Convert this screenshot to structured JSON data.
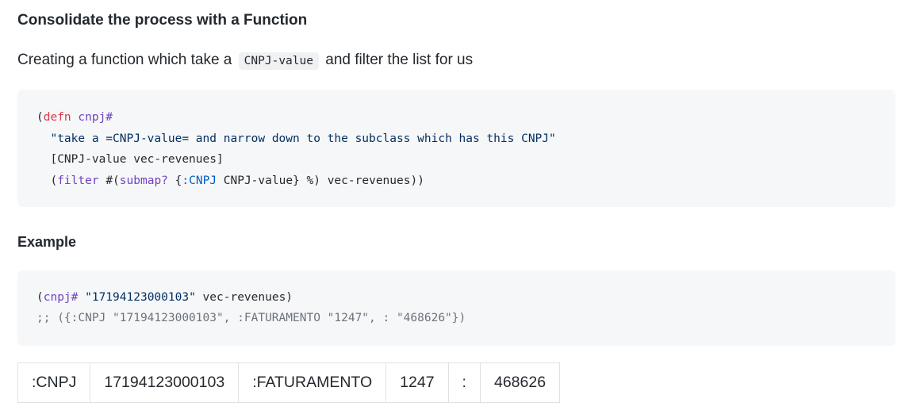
{
  "section": {
    "title": "Consolidate the process with a Function"
  },
  "intro": {
    "before": "Creating a function which take a",
    "code": "CNPJ-value",
    "after": "and filter the list for us"
  },
  "code_block_1": {
    "lines": [
      [
        {
          "t": "(",
          "c": "punc"
        },
        {
          "t": "defn",
          "c": "kw"
        },
        {
          "t": " ",
          "c": "punc"
        },
        {
          "t": "cnpj#",
          "c": "fn"
        }
      ],
      [
        {
          "t": "  ",
          "c": "punc"
        },
        {
          "t": "\"take a =CNPJ-value= and narrow down to the subclass which has this CNPJ\"",
          "c": "str"
        }
      ],
      [
        {
          "t": "  [CNPJ-value vec-revenues]",
          "c": "punc"
        }
      ],
      [
        {
          "t": "  (",
          "c": "punc"
        },
        {
          "t": "filter",
          "c": "fn"
        },
        {
          "t": " #(",
          "c": "punc"
        },
        {
          "t": "submap?",
          "c": "fn"
        },
        {
          "t": " {",
          "c": "punc"
        },
        {
          "t": ":CNPJ",
          "c": "kwd"
        },
        {
          "t": " CNPJ-value} %) vec-revenues))",
          "c": "punc"
        }
      ]
    ]
  },
  "example": {
    "title": "Example"
  },
  "code_block_2": {
    "lines": [
      [
        {
          "t": "(",
          "c": "punc"
        },
        {
          "t": "cnpj#",
          "c": "fn"
        },
        {
          "t": " ",
          "c": "punc"
        },
        {
          "t": "\"17194123000103\"",
          "c": "strg"
        },
        {
          "t": " vec-revenues)",
          "c": "punc"
        }
      ],
      [
        {
          "t": ";; ({:CNPJ \"17194123000103\", :FATURAMENTO \"1247\", : \"468626\"})",
          "c": "cmt"
        }
      ]
    ]
  },
  "result_table": {
    "cells": [
      ":CNPJ",
      "17194123000103",
      ":FATURAMENTO",
      "1247",
      ":",
      "468626"
    ]
  }
}
